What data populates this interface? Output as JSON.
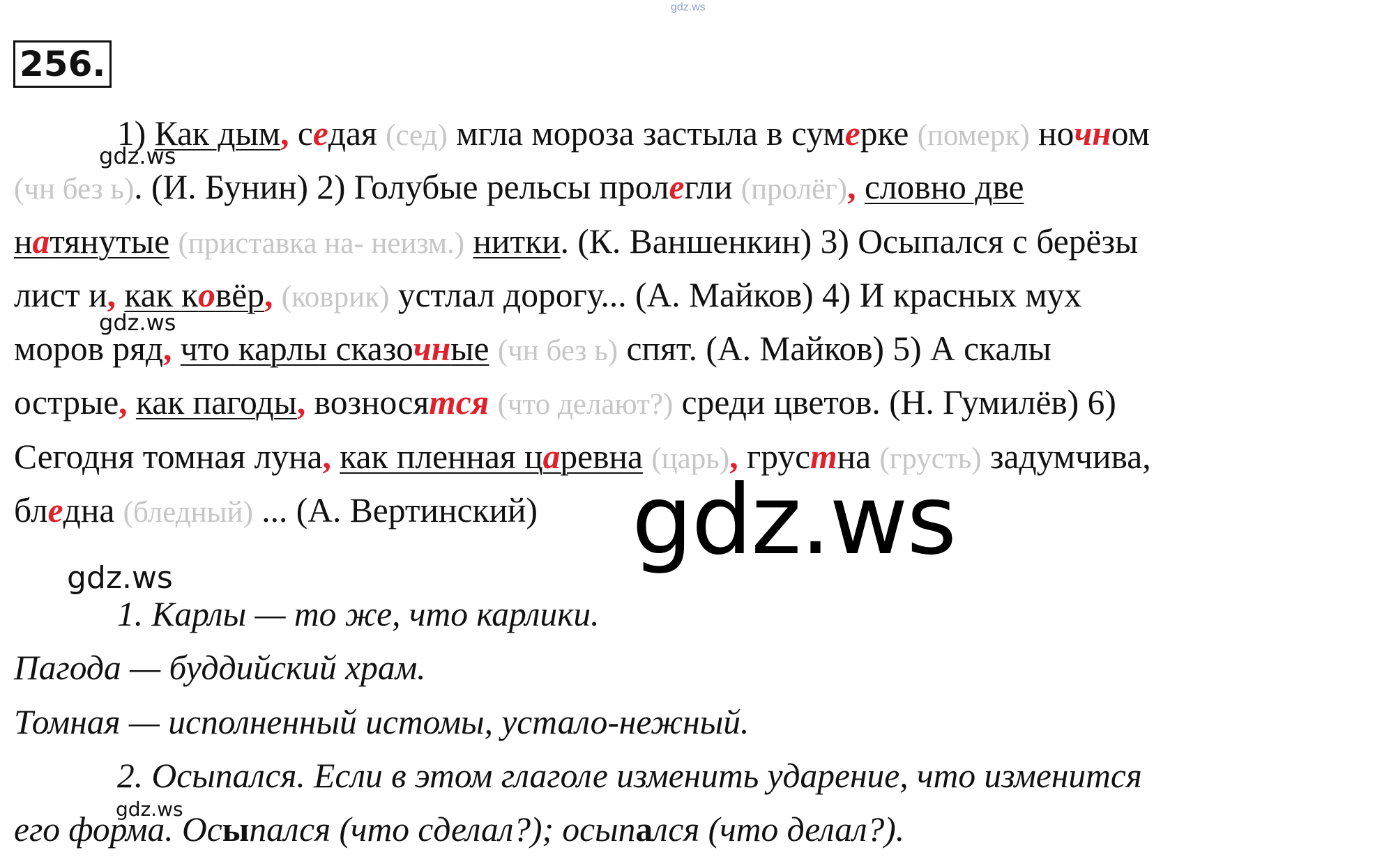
{
  "header": {
    "watermark_top": "gdz.ws",
    "exercise_number": "256."
  },
  "watermarks": {
    "small": "gdz.ws",
    "large": "gdz.ws"
  },
  "main_text": {
    "l1": [
      "1) ",
      "Как дым",
      ", ",
      "с",
      "е",
      "дая ",
      "(сед)",
      " мгла мороза застыла в сум",
      "е",
      "рке ",
      "(померк)",
      " но",
      "чн",
      "ом"
    ],
    "l2": [
      "(чн без ь)",
      ". (И. Бунин) 2) Голубые рельсы прол",
      "е",
      "гли ",
      "(пролёг)",
      ",",
      " ",
      "словно две"
    ],
    "l3": [
      "н",
      "а",
      "тянутые",
      " ",
      "(приставка на- неизм.)",
      " ",
      "нитки",
      ". (К. Ваншенкин) 3) Осыпался с берёзы"
    ],
    "l4": [
      "лист и",
      ",",
      " ",
      "как к",
      "о",
      "вёр",
      ",",
      " ",
      "(коврик)",
      " устлал дорогу... (А. Майков) 4) И красных мух"
    ],
    "l5": [
      "моров ряд",
      ",",
      " ",
      "что карлы сказо",
      "чн",
      "ые",
      " ",
      "(чн без ь)",
      " спят. (А. Майков) 5) А скалы"
    ],
    "l6": [
      "острые",
      ",",
      " ",
      "как пагоды",
      ",",
      " вознося",
      "тся",
      " ",
      "(что делают?)",
      " среди цветов. (Н. Гумилёв) 6)"
    ],
    "l7": [
      "Сегодня томная луна",
      ",",
      " ",
      "как пленная ц",
      "а",
      "ревна",
      " ",
      "(царь)",
      ",",
      " грус",
      "т",
      "на ",
      "(грусть)",
      " задумчива,"
    ],
    "l8": [
      "бл",
      "е",
      "дна ",
      "(бледный)",
      " ... (А. Вертинский)"
    ]
  },
  "notes": {
    "n1": "1. Карлы — то же, что карлики.",
    "n2": "Пагода — буддийский храм.",
    "n3": "Томная — исполненный истомы, устало-нежный.",
    "n4": "2. Осыпался. Если в этом глаголе изменить ударение, что изменится",
    "n5": [
      "его форма. Ос",
      "ы",
      "пался (что сделал?); осып",
      "а",
      "лся (что делал?)."
    ]
  },
  "colors": {
    "highlight": "#e0202a",
    "hint_gray": "#c6c6c6",
    "watermark_top": "#8da0c6"
  }
}
